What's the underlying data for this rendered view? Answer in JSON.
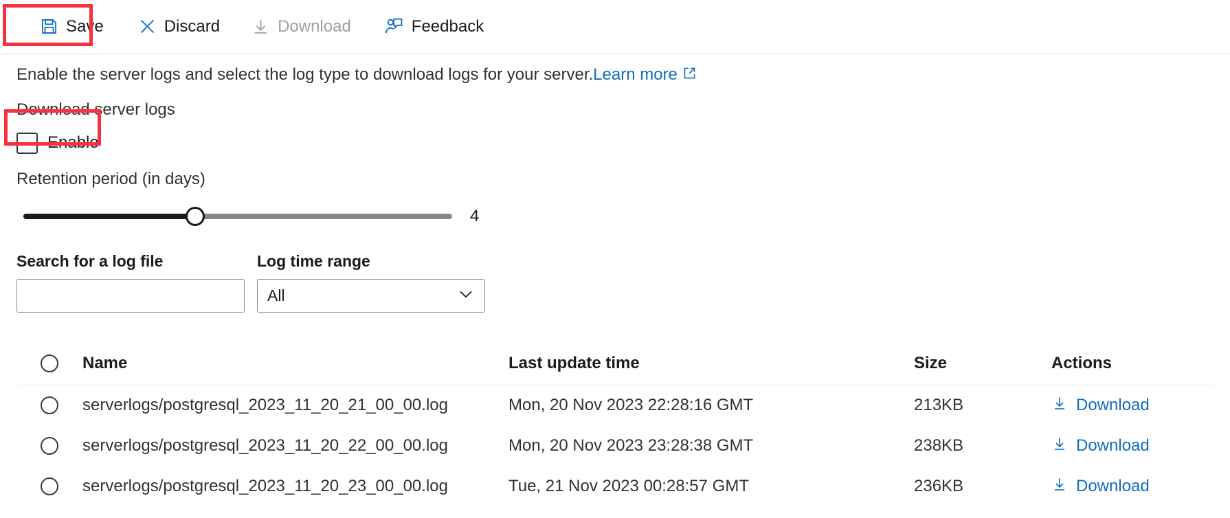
{
  "toolbar": {
    "items": [
      {
        "id": "save",
        "label": "Save",
        "icon": "save-icon",
        "disabled": false
      },
      {
        "id": "discard",
        "label": "Discard",
        "icon": "discard-icon",
        "disabled": false
      },
      {
        "id": "download",
        "label": "Download",
        "icon": "download-icon",
        "disabled": true
      },
      {
        "id": "feedback",
        "label": "Feedback",
        "icon": "feedback-icon",
        "disabled": false
      }
    ]
  },
  "description": {
    "text": "Enable the server logs and select the log type to download logs for your server.",
    "link_label": "Learn more",
    "link_icon": "external-link-icon"
  },
  "settings": {
    "section_label": "Download server logs",
    "enable_label": "Enable",
    "enable_checked": false,
    "retention_label": "Retention period (in days)",
    "retention_value": "4",
    "retention_percent": 40
  },
  "filters": {
    "search_label": "Search for a log file",
    "search_value": "",
    "search_placeholder": "",
    "range_label": "Log time range",
    "range_value": "All",
    "range_options": [
      "All"
    ]
  },
  "table": {
    "columns": {
      "name": "Name",
      "time": "Last update time",
      "size": "Size",
      "actions": "Actions"
    },
    "download_label": "Download",
    "rows": [
      {
        "name": "serverlogs/postgresql_2023_11_20_21_00_00.log",
        "time": "Mon, 20 Nov 2023 22:28:16 GMT",
        "size": "213KB",
        "action": "Download",
        "selected": false
      },
      {
        "name": "serverlogs/postgresql_2023_11_20_22_00_00.log",
        "time": "Mon, 20 Nov 2023 23:28:38 GMT",
        "size": "238KB",
        "action": "Download",
        "selected": false
      },
      {
        "name": "serverlogs/postgresql_2023_11_20_23_00_00.log",
        "time": "Tue, 21 Nov 2023 00:28:57 GMT",
        "size": "236KB",
        "action": "Download",
        "selected": false
      }
    ]
  },
  "annotations": {
    "highlight_color": "#f5333f",
    "highlight_targets": [
      "save-button",
      "enable-checkbox"
    ]
  },
  "colors": {
    "link": "#0f6cbd",
    "accent": "#0078d4",
    "text": "#1b1a19",
    "disabled_text": "#a19f9d",
    "border": "#8a8886"
  }
}
